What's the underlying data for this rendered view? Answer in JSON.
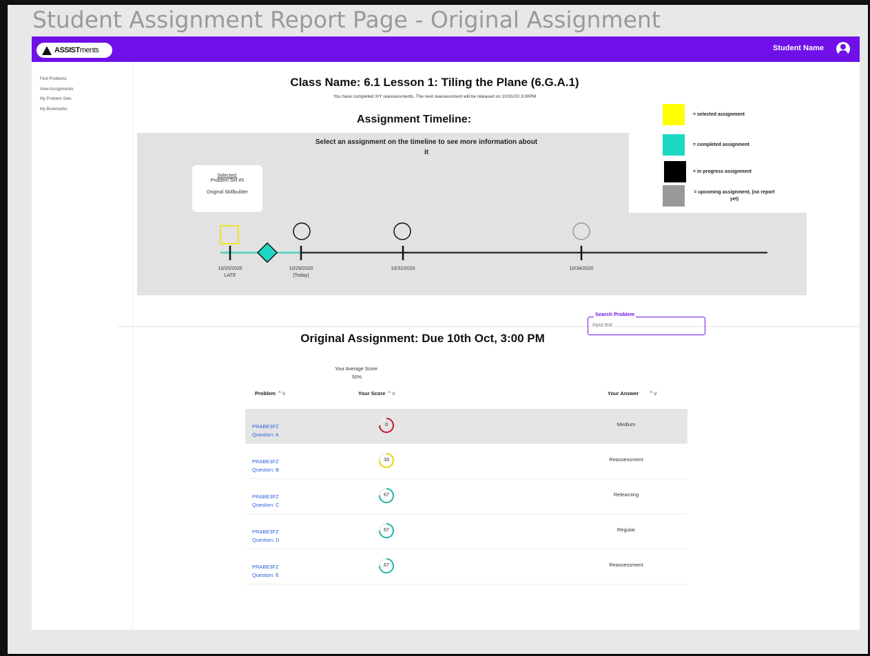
{
  "page_heading": "Student Assignment Report Page - Original Assignment",
  "header": {
    "logo_text_bold": "ASSIST",
    "logo_text_light": "ments",
    "user_name": "Student Name"
  },
  "sidebar": {
    "items": [
      {
        "label": "Find Problems"
      },
      {
        "label": "View Assignments"
      },
      {
        "label": "My Problem Sets"
      },
      {
        "label": "My Bookmarks"
      }
    ]
  },
  "class_title": "Class Name: 6.1 Lesson 1: Tiling the Plane (6.G.A.1)",
  "notice": "You have completed X/Y reassessments. The next reassessment will be released on 10/31/20 3:00PM",
  "timeline": {
    "title": "Assignment Timeline:",
    "hint": "Select an assignment on the timeline to see more information about it",
    "selected_card": {
      "label": "Selected:",
      "problem_set": "Problem Set #5",
      "type": "Original Skillbuilder"
    },
    "ticks": [
      {
        "date": "10/20/2020",
        "note": "LATE"
      },
      {
        "date": "10/29/2020",
        "note": "(Today)"
      },
      {
        "date": "10/31/2020",
        "note": ""
      },
      {
        "date": "10/34/2020",
        "note": ""
      }
    ]
  },
  "legend": {
    "items": [
      {
        "label": "= selected assignment",
        "color": "#ffff00"
      },
      {
        "label": "= completed assignment",
        "color": "#1dd8c4"
      },
      {
        "label": "= in progress assignment",
        "color": "#000000"
      },
      {
        "label": "= upcoming assignment, (no report yet)",
        "color": "#999999"
      }
    ]
  },
  "search": {
    "label": "Search Problem",
    "placeholder": "Input text"
  },
  "assignment": {
    "title": "Original Assignment: Due 10th Oct, 3:00 PM",
    "avg_label": "Your Average Score",
    "avg_value": "50%"
  },
  "table": {
    "headers": {
      "problem": "Problem",
      "score": "Your Score",
      "answer": "Your Answer"
    },
    "rows": [
      {
        "code": "PRABE3FZ",
        "question": "Question: A",
        "score": 0,
        "answer": "Medium",
        "color": "#c8102e"
      },
      {
        "code": "PRABE3FZ",
        "question": "Question: B",
        "score": 33,
        "answer": "Reassessment",
        "color": "#e6d800"
      },
      {
        "code": "PRABE3FZ",
        "question": "Question: C",
        "score": 67,
        "answer": "Relearning",
        "color": "#1db8a4"
      },
      {
        "code": "PRABE3FZ",
        "question": "Question: D",
        "score": 67,
        "answer": "Regular",
        "color": "#1db8a4"
      },
      {
        "code": "PRABE3FZ",
        "question": "Question: E",
        "score": 67,
        "answer": "Reassessment",
        "color": "#1db8a4"
      }
    ]
  }
}
